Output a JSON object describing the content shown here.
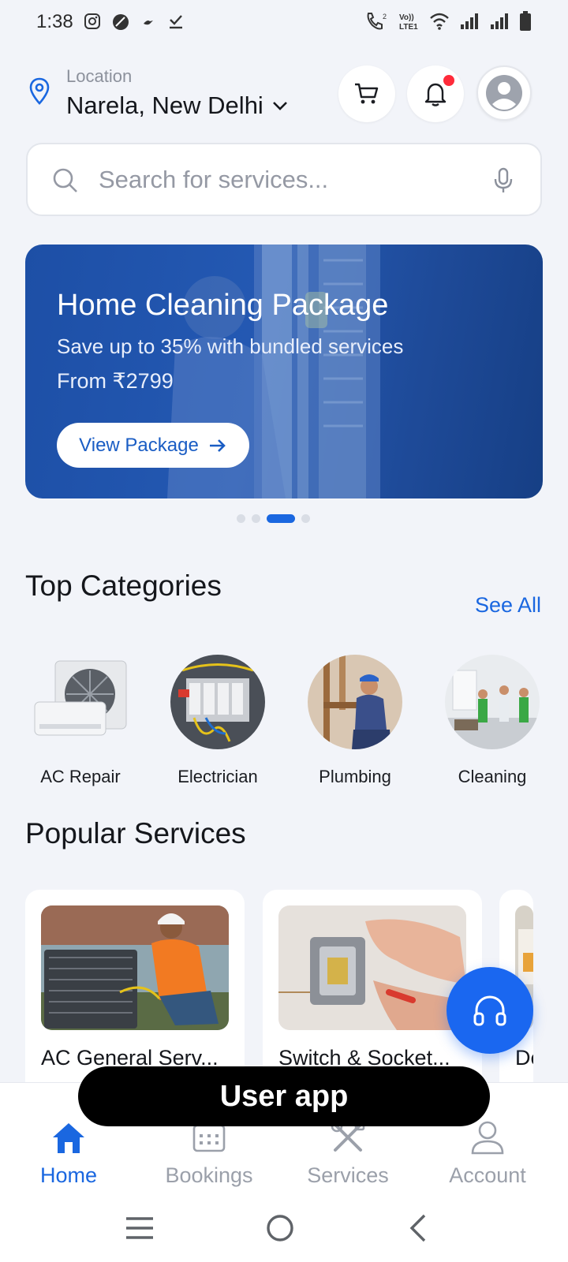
{
  "status_bar": {
    "time": "1:38",
    "left_icons": [
      "instagram-icon",
      "app-icon",
      "bird-icon",
      "check-icon"
    ],
    "right_icons": [
      "volte-call-icon",
      "lte-icon",
      "wifi-icon",
      "signal-icon",
      "signal-icon",
      "battery-icon"
    ]
  },
  "header": {
    "location_label": "Location",
    "location_value": "Narela, New Delhi",
    "cart_icon": "cart-icon",
    "bell_icon": "bell-icon",
    "avatar_icon": "user-avatar-icon"
  },
  "search": {
    "placeholder": "Search for services...",
    "value": ""
  },
  "banner": {
    "title": "Home Cleaning Package",
    "subtitle": "Save up to 35% with bundled services",
    "price": "From ₹2799",
    "button_label": "View Package",
    "active_slide": 3,
    "slide_count": 4
  },
  "categories": {
    "title": "Top Categories",
    "see_all": "See All",
    "items": [
      {
        "label": "AC Repair"
      },
      {
        "label": "Electrician"
      },
      {
        "label": "Plumbing"
      },
      {
        "label": "Cleaning"
      }
    ]
  },
  "popular": {
    "title": "Popular Services",
    "items": [
      {
        "title": "AC General Serv..."
      },
      {
        "title": "Switch & Socket..."
      },
      {
        "title": "De"
      }
    ]
  },
  "overlay_label": "User app",
  "bottom_nav": {
    "items": [
      {
        "label": "Home",
        "icon": "home-icon"
      },
      {
        "label": "Bookings",
        "icon": "calendar-icon"
      },
      {
        "label": "Services",
        "icon": "tools-icon"
      },
      {
        "label": "Account",
        "icon": "person-icon"
      }
    ],
    "active": "Home"
  },
  "colors": {
    "accent": "#1a67e0",
    "background": "#f2f4f9",
    "banner": "#2459b3",
    "notification": "#ff2b3a"
  }
}
